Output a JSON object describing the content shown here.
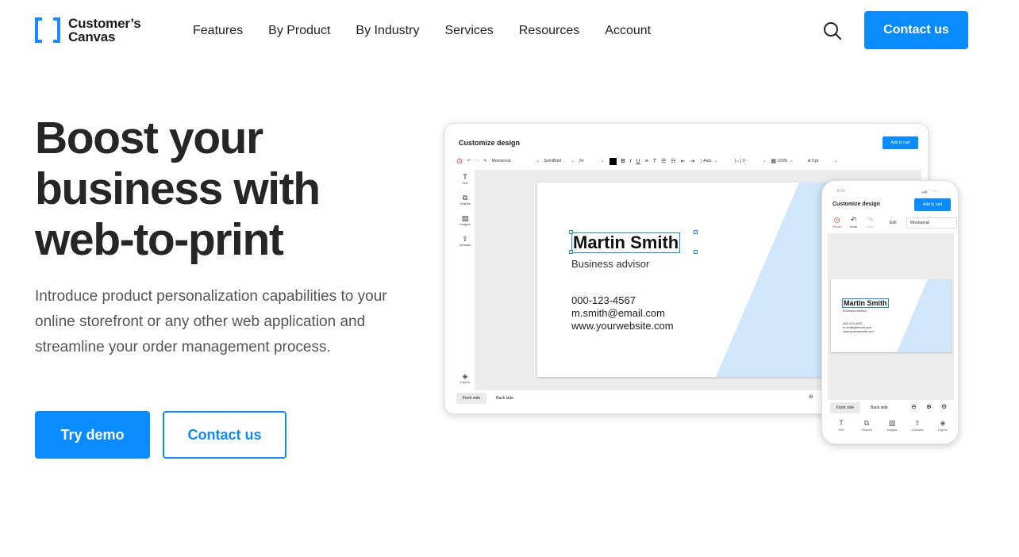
{
  "header": {
    "logo_line1": "Customer’s",
    "logo_line2": "Canvas",
    "nav": [
      "Features",
      "By Product",
      "By Industry",
      "Services",
      "Resources",
      "Account"
    ],
    "contact_label": "Contact us"
  },
  "hero": {
    "title": "Boost your business with web-to-print",
    "description": "Introduce product personalization capabilities to your online storefront or any other web application and streamline your order management process.",
    "try_demo_label": "Try demo",
    "contact_label": "Contact us"
  },
  "desktop_editor": {
    "title": "Customize design",
    "add_to_cart": "Add to cart",
    "font": "Montserrat",
    "weight": "SemiBold",
    "size": "24",
    "line_height": "Auto",
    "letter_spacing": "0",
    "opacity": "100%",
    "stroke": "0 pt",
    "sidebar": [
      "Text",
      "Shapes",
      "Images",
      "Uploads"
    ],
    "layers_label": "Layers",
    "tabs": [
      "Front side",
      "Back side"
    ]
  },
  "card": {
    "name": "Martin Smith",
    "role": "Business advisor",
    "phone": "000-123-4567",
    "email": "m.smith@email.com",
    "website": "www.yourwebsite.com"
  },
  "phone_editor": {
    "time": "8:15",
    "title": "Customize design",
    "add_to_cart": "Add to cart",
    "tools": [
      "Recall",
      "Undo",
      "Redo"
    ],
    "edit_label": "Edit",
    "font": "Montserrat",
    "tabs": [
      "Front side",
      "Back side"
    ],
    "bottom": [
      "Text",
      "Shapes",
      "Images",
      "Uploads",
      "Layers"
    ]
  },
  "colors": {
    "accent": "#0a8cff",
    "card_stripe": "#cfe6fb"
  }
}
